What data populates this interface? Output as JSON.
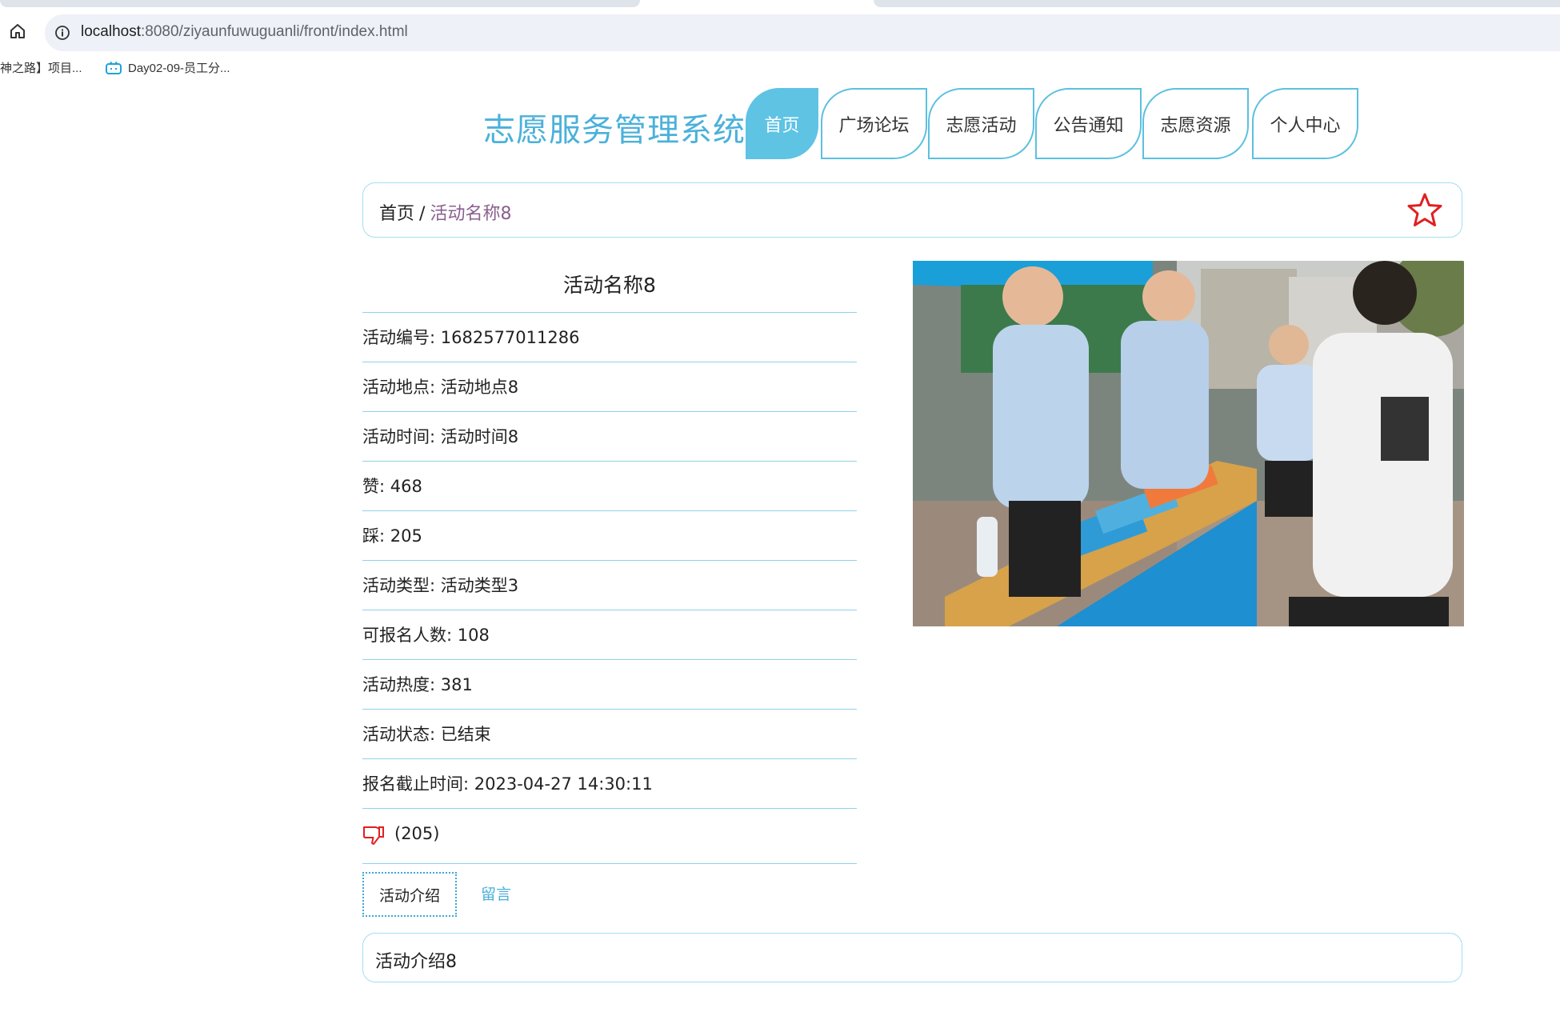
{
  "browser": {
    "url_host": "localhost",
    "url_path": ":8080/ziyaunfuwuguanli/front/index.html",
    "bookmarks": [
      {
        "label": "神之路】项目..."
      },
      {
        "label": "Day02-09-员工分..."
      }
    ]
  },
  "site": {
    "title": "志愿服务管理系统",
    "nav": [
      {
        "label": "首页",
        "active": true
      },
      {
        "label": "广场论坛",
        "active": false
      },
      {
        "label": "志愿活动",
        "active": false
      },
      {
        "label": "公告通知",
        "active": false
      },
      {
        "label": "志愿资源",
        "active": false
      },
      {
        "label": "个人中心",
        "active": false
      }
    ]
  },
  "breadcrumb": {
    "home": "首页",
    "separator": "/",
    "current": "活动名称8"
  },
  "detail": {
    "title": "活动名称8",
    "fields": [
      {
        "label": "活动编号",
        "value": "1682577011286"
      },
      {
        "label": "活动地点",
        "value": "活动地点8"
      },
      {
        "label": "活动时间",
        "value": "活动时间8"
      },
      {
        "label": "赞",
        "value": "468"
      },
      {
        "label": "踩",
        "value": "205"
      },
      {
        "label": "活动类型",
        "value": "活动类型3"
      },
      {
        "label": "可报名人数",
        "value": "108"
      },
      {
        "label": "活动热度",
        "value": "381"
      },
      {
        "label": "活动状态",
        "value": "已结束"
      },
      {
        "label": "报名截止时间",
        "value": "2023-04-27 14:30:11"
      }
    ],
    "dislike_count": "(205)"
  },
  "tabs": [
    {
      "label": "活动介绍",
      "active": true
    },
    {
      "label": "留言",
      "active": false
    }
  ],
  "intro": {
    "text": "活动介绍8"
  },
  "colors": {
    "accent": "#4bb1da",
    "nav_active_bg": "#5fc3e4",
    "border": "#8fd2ea",
    "star": "#e02020",
    "dislike": "#e02020",
    "breadcrumb_current": "#8a5f8e"
  }
}
